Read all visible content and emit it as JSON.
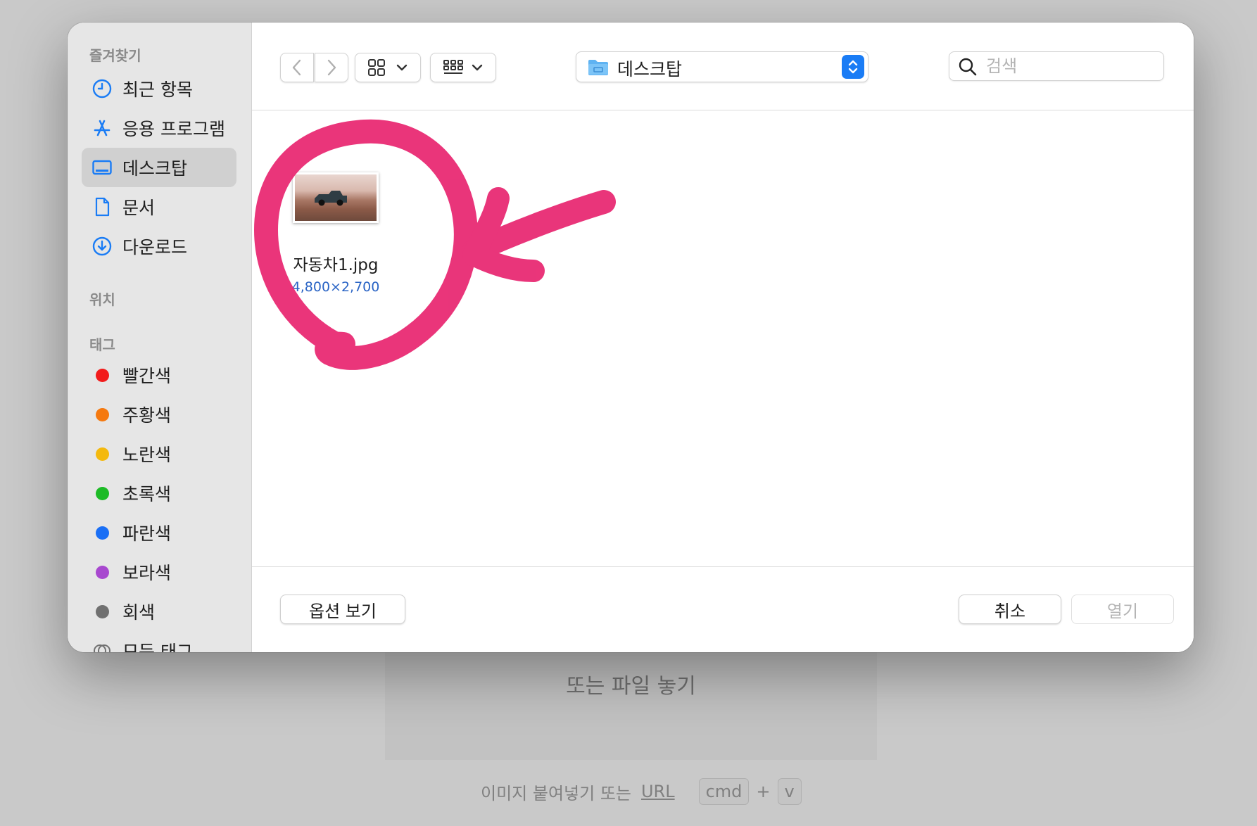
{
  "background": {
    "drop_label": "또는 파일 놓기",
    "paste_label": "이미지 붙여넣기 또는",
    "url_label": "URL",
    "key_cmd": "cmd",
    "key_plus": "+",
    "key_v": "v"
  },
  "sidebar": {
    "favorites_heading": "즐겨찾기",
    "favorites": [
      {
        "label": "최근 항목",
        "icon": "clock-icon"
      },
      {
        "label": "응용 프로그램",
        "icon": "apps-icon"
      },
      {
        "label": "데스크탑",
        "icon": "desktop-icon",
        "active": true
      },
      {
        "label": "문서",
        "icon": "document-icon"
      },
      {
        "label": "다운로드",
        "icon": "download-icon"
      }
    ],
    "locations_heading": "위치",
    "tags_heading": "태그",
    "tags": [
      {
        "label": "빨간색",
        "color": "#f21b1b"
      },
      {
        "label": "주황색",
        "color": "#f5790f"
      },
      {
        "label": "노란색",
        "color": "#f4b90d"
      },
      {
        "label": "초록색",
        "color": "#1dbb26"
      },
      {
        "label": "파란색",
        "color": "#1a6ff5"
      },
      {
        "label": "보라색",
        "color": "#a848cf"
      },
      {
        "label": "회색",
        "color": "#707070"
      }
    ],
    "all_tags_label": "모든 태그"
  },
  "toolbar": {
    "location": "데스크탑",
    "search_placeholder": "검색"
  },
  "files": [
    {
      "name": "자동차1.jpg",
      "dimensions": "4,800×2,700"
    }
  ],
  "footer": {
    "options_label": "옵션 보기",
    "cancel_label": "취소",
    "open_label": "열기"
  },
  "colors": {
    "accent": "#1a7cf5",
    "annotation": "#e8246f"
  }
}
